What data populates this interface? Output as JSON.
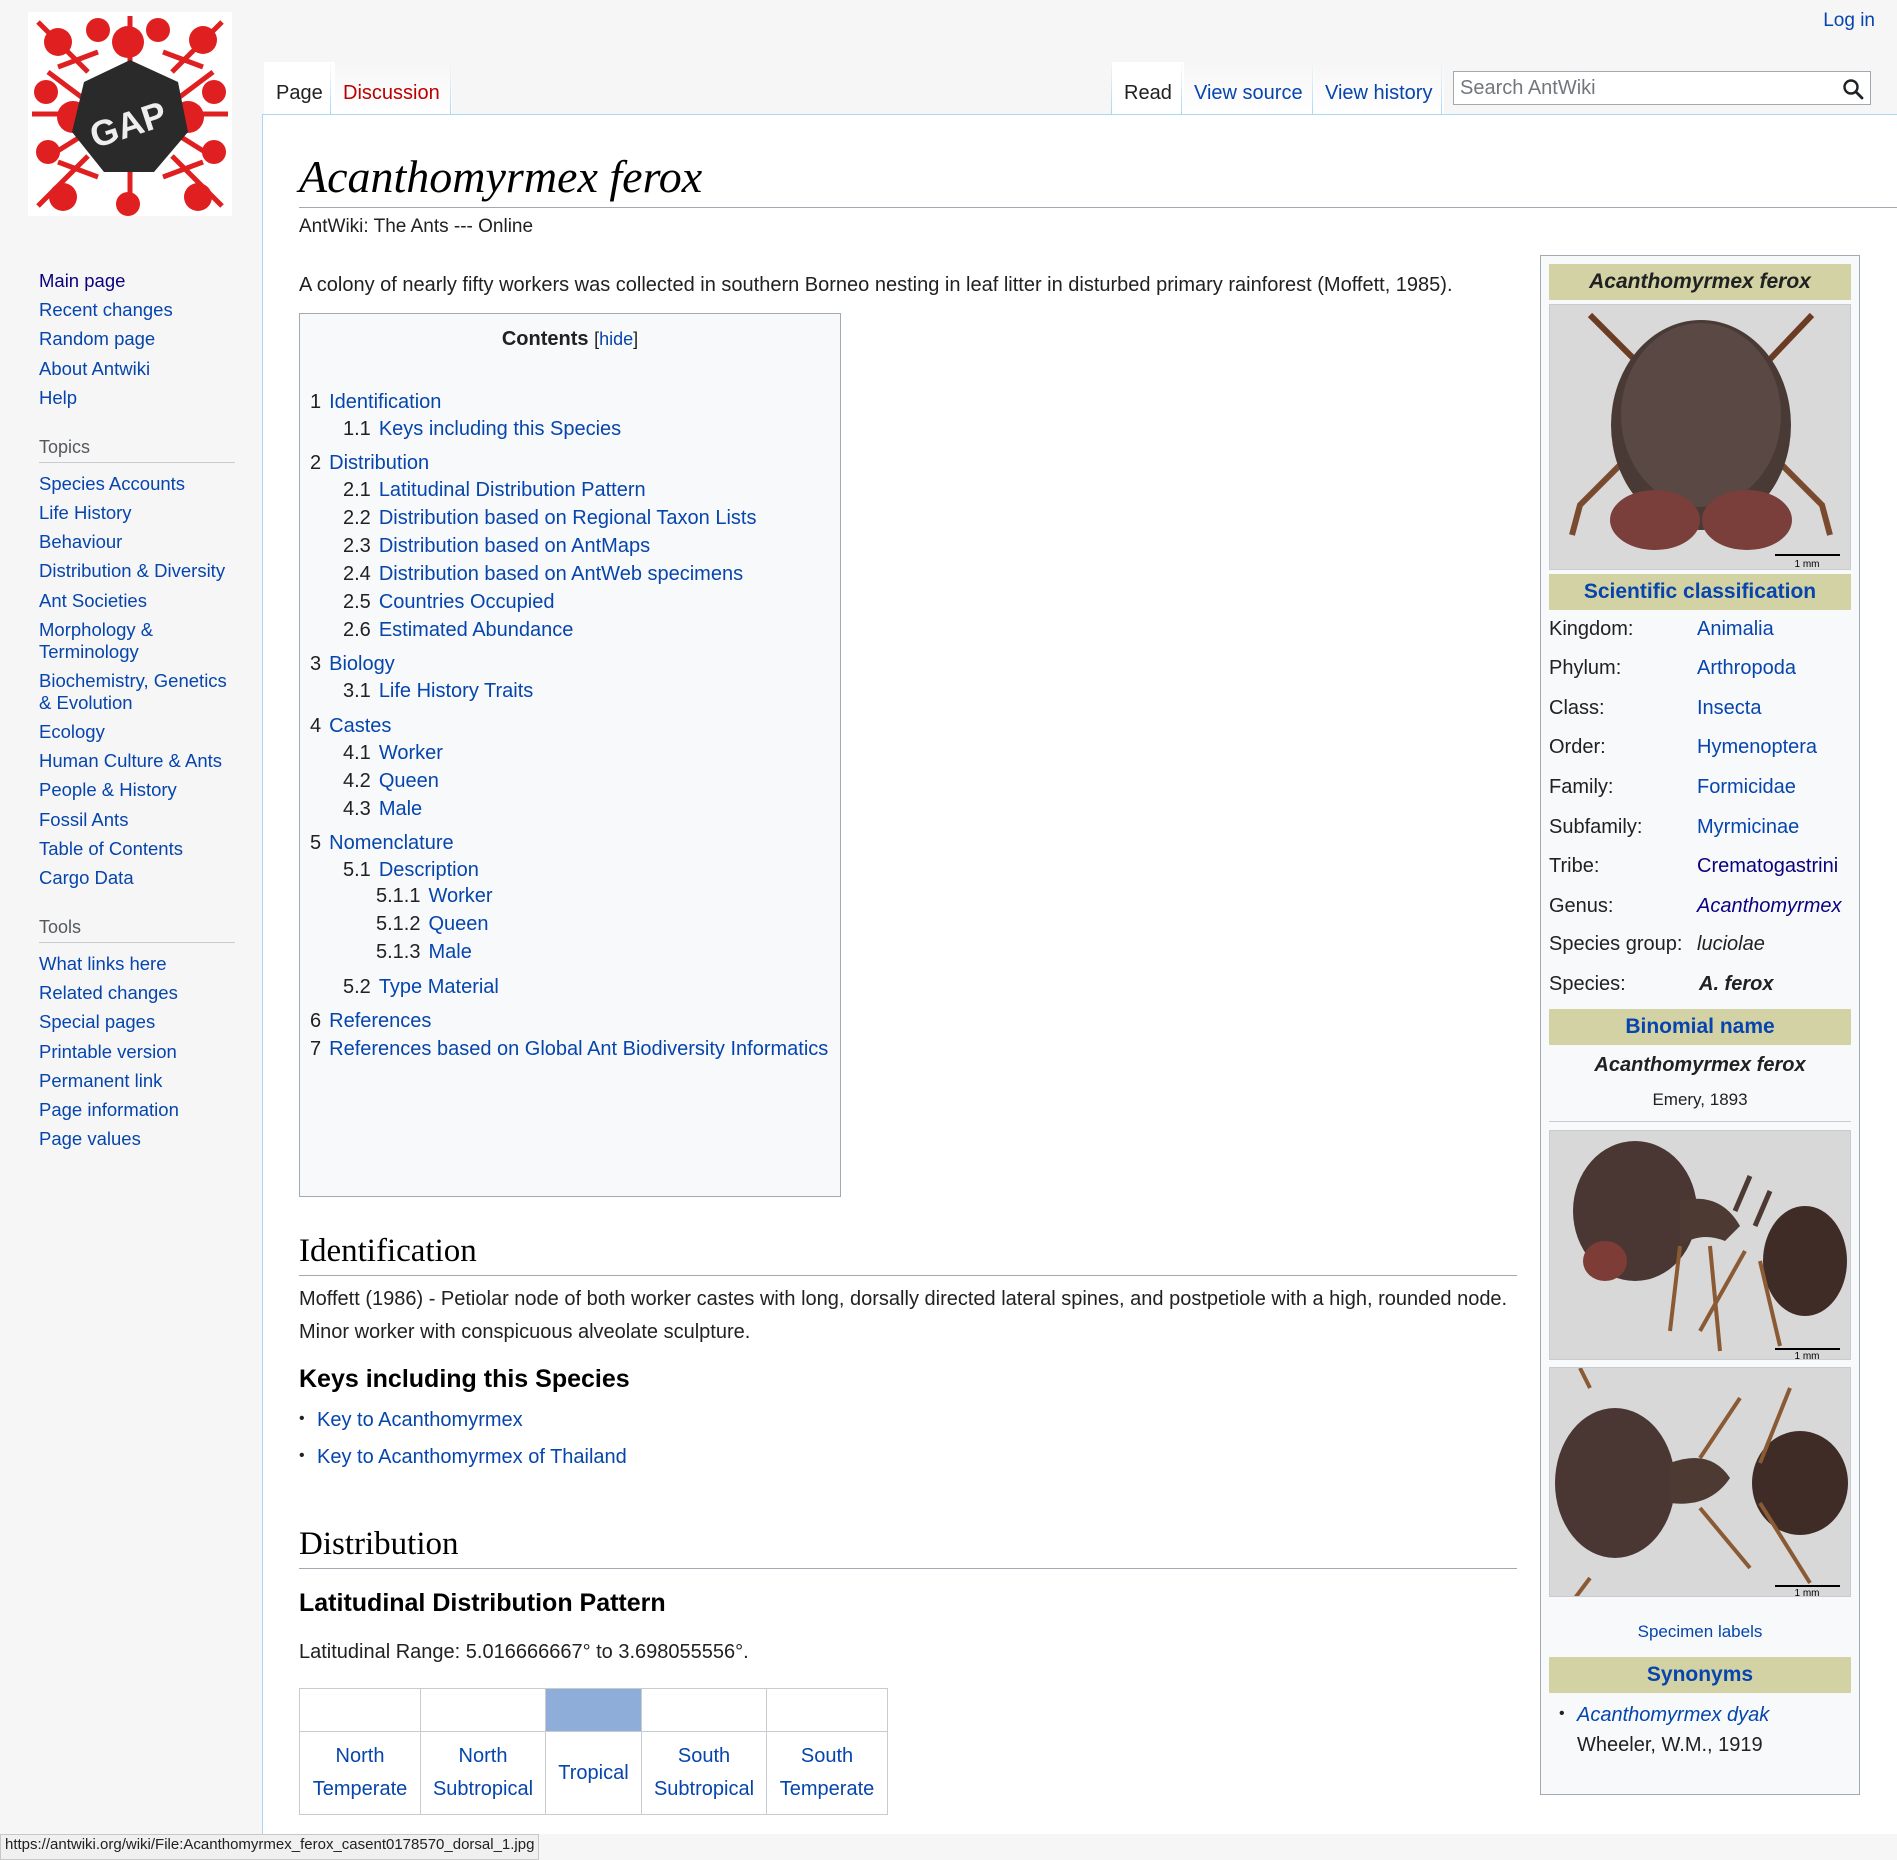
{
  "personal": {
    "login": "Log in"
  },
  "tabs": {
    "page": "Page",
    "discussion": "Discussion",
    "read": "Read",
    "view_source": "View source",
    "view_history": "View history"
  },
  "search": {
    "placeholder": "Search AntWiki"
  },
  "logo": {
    "text": "GAP"
  },
  "sidebar": {
    "nav": [
      "Main page",
      "Recent changes",
      "Random page",
      "About Antwiki",
      "Help"
    ],
    "topics_heading": "Topics",
    "topics": [
      "Species Accounts",
      "Life History",
      "Behaviour",
      "Distribution & Diversity",
      "Ant Societies",
      "Morphology & Terminology",
      "Biochemistry, Genetics & Evolution",
      "Ecology",
      "Human Culture & Ants",
      "People & History",
      "Fossil Ants",
      "Table of Contents",
      "Cargo Data"
    ],
    "tools_heading": "Tools",
    "tools": [
      "What links here",
      "Related changes",
      "Special pages",
      "Printable version",
      "Permanent link",
      "Page information",
      "Page values"
    ]
  },
  "page": {
    "title": "Acanthomyrmex ferox",
    "tagline": "AntWiki: The Ants --- Online",
    "intro": "A colony of nearly fifty workers was collected in southern Borneo nesting in leaf litter in disturbed primary rainforest (Moffett, 1985)."
  },
  "toc": {
    "title": "Contents",
    "hide": "hide",
    "items": [
      {
        "num": "1",
        "label": "Identification"
      },
      {
        "num": "1.1",
        "label": "Keys including this Species"
      },
      {
        "num": "2",
        "label": "Distribution"
      },
      {
        "num": "2.1",
        "label": "Latitudinal Distribution Pattern"
      },
      {
        "num": "2.2",
        "label": "Distribution based on Regional Taxon Lists"
      },
      {
        "num": "2.3",
        "label": "Distribution based on AntMaps"
      },
      {
        "num": "2.4",
        "label": "Distribution based on AntWeb specimens"
      },
      {
        "num": "2.5",
        "label": "Countries Occupied"
      },
      {
        "num": "2.6",
        "label": "Estimated Abundance"
      },
      {
        "num": "3",
        "label": "Biology"
      },
      {
        "num": "3.1",
        "label": "Life History Traits"
      },
      {
        "num": "4",
        "label": "Castes"
      },
      {
        "num": "4.1",
        "label": "Worker"
      },
      {
        "num": "4.2",
        "label": "Queen"
      },
      {
        "num": "4.3",
        "label": "Male"
      },
      {
        "num": "5",
        "label": "Nomenclature"
      },
      {
        "num": "5.1",
        "label": "Description"
      },
      {
        "num": "5.1.1",
        "label": "Worker"
      },
      {
        "num": "5.1.2",
        "label": "Queen"
      },
      {
        "num": "5.1.3",
        "label": "Male"
      },
      {
        "num": "5.2",
        "label": "Type Material"
      },
      {
        "num": "6",
        "label": "References"
      },
      {
        "num": "7",
        "label": "References based on Global Ant Biodiversity Informatics"
      }
    ]
  },
  "identification": {
    "heading": "Identification",
    "text": "Moffett (1986) - Petiolar node of both worker castes with long, dorsally directed lateral spines, and postpetiole with a high, rounded node. Minor worker with conspicuous alveolate sculpture.",
    "keys_heading": "Keys including this Species",
    "keys": [
      "Key to Acanthomyrmex",
      "Key to Acanthomyrmex of Thailand"
    ]
  },
  "distribution": {
    "heading": "Distribution",
    "lat_heading": "Latitudinal Distribution Pattern",
    "lat_range": "Latitudinal Range: 5.016666667° to 3.698055556°.",
    "zones": [
      {
        "line1": "North",
        "line2": "Temperate"
      },
      {
        "line1": "North",
        "line2": "Subtropical"
      },
      {
        "line1": "Tropical",
        "line2": ""
      },
      {
        "line1": "South",
        "line2": "Subtropical"
      },
      {
        "line1": "South",
        "line2": "Temperate"
      }
    ],
    "highlight_color": "#8eadd9"
  },
  "infobox": {
    "title": "Acanthomyrmex ferox",
    "scale_label": "1 mm",
    "sci_heading": "Scientific classification",
    "classification": [
      {
        "key": "Kingdom:",
        "value": "Animalia"
      },
      {
        "key": "Phylum:",
        "value": "Arthropoda"
      },
      {
        "key": "Class:",
        "value": "Insecta"
      },
      {
        "key": "Order:",
        "value": "Hymenoptera"
      },
      {
        "key": "Family:",
        "value": "Formicidae"
      },
      {
        "key": "Subfamily:",
        "value": "Myrmicinae"
      },
      {
        "key": "Tribe:",
        "value": "Crematogastrini"
      },
      {
        "key": "Genus:",
        "value": "Acanthomyrmex"
      },
      {
        "key": "Species group:",
        "value": "luciolae"
      },
      {
        "key": "Species:",
        "value": "A. ferox"
      }
    ],
    "binomial_heading": "Binomial name",
    "binomial": "Acanthomyrmex ferox",
    "authority": "Emery, 1893",
    "specimen_labels": "Specimen labels",
    "synonyms_heading": "Synonyms",
    "synonym": "Acanthomyrmex dyak",
    "synonym_author": "Wheeler, W.M., 1919",
    "header_color": "#d3d2a5"
  },
  "statusbar": {
    "url": "https://antwiki.org/wiki/File:Acanthomyrmex_ferox_casent0178570_dorsal_1.jpg"
  }
}
